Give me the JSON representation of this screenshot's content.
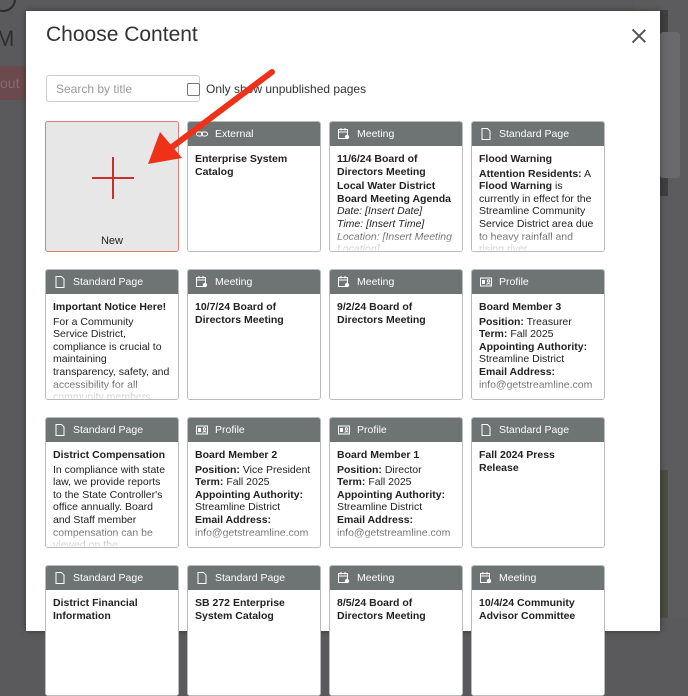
{
  "background": {
    "title_fragment": "M L",
    "about_fragment": "out",
    "accent_color": "#c9302c"
  },
  "modal": {
    "title": "Choose Content",
    "close_label": "Close",
    "search": {
      "placeholder": "Search by title",
      "value": ""
    },
    "unpublished_filter": {
      "label": "Only show unpublished pages",
      "checked": false
    },
    "new_card": {
      "label": "New"
    }
  },
  "cards": [
    {
      "type": "External",
      "icon": "link-icon",
      "title": "Enterprise System Catalog",
      "lines": []
    },
    {
      "type": "Meeting",
      "icon": "calendar-icon",
      "title": "11/6/24 Board of Directors Meeting",
      "lines": [
        {
          "style": "bold",
          "text": "Local Water District Board Meeting Agenda"
        },
        {
          "style": "italic",
          "text": "Date: [Insert Date]"
        },
        {
          "style": "italic",
          "text": "Time: [Insert Time]"
        },
        {
          "style": "italic",
          "text": "Location: [Insert Meeting Location]"
        }
      ]
    },
    {
      "type": "Standard Page",
      "icon": "page-icon",
      "title": "Flood Warning",
      "lines": [
        {
          "style": "mixed",
          "parts": [
            {
              "b": true,
              "text": "Attention Residents:"
            },
            {
              "b": false,
              "text": " A "
            },
            {
              "b": true,
              "text": "Flood Warning"
            },
            {
              "b": false,
              "text": " is currently in effect for the Streamline Community Service District area due to heavy rainfall and rising river"
            }
          ]
        }
      ]
    },
    {
      "type": "Standard Page",
      "icon": "page-icon",
      "title": "Important Notice Here!",
      "lines": [
        {
          "style": "normal",
          "text": "For a Community Service District, compliance is crucial to maintaining transparency, safety, and accessibility for all community members. Our district"
        }
      ]
    },
    {
      "type": "Meeting",
      "icon": "calendar-icon",
      "title": "10/7/24 Board of Directors Meeting",
      "lines": []
    },
    {
      "type": "Meeting",
      "icon": "calendar-icon",
      "title": "9/2/24 Board of Directors Meeting",
      "lines": []
    },
    {
      "type": "Profile",
      "icon": "profile-icon",
      "title": "Board Member 3",
      "lines": [
        {
          "style": "kv",
          "k": "Position:",
          "v": " Treasurer"
        },
        {
          "style": "kv",
          "k": "Term:",
          "v": " Fall 2025"
        },
        {
          "style": "bold",
          "text": "Appointing Authority:"
        },
        {
          "style": "normal",
          "text": "Streamline District"
        },
        {
          "style": "bold",
          "text": "Email Address:"
        },
        {
          "style": "normal",
          "text": "info@getstreamline.com"
        }
      ]
    },
    {
      "type": "Standard Page",
      "icon": "page-icon",
      "title": "District Compensation",
      "lines": [
        {
          "style": "normal",
          "text": "In compliance with state law, we provide reports to the State Controller's office annually. Board and Staff member compensation can be viewed on the"
        }
      ]
    },
    {
      "type": "Profile",
      "icon": "profile-icon",
      "title": "Board Member 2",
      "lines": [
        {
          "style": "kv",
          "k": "Position:",
          "v": " Vice President"
        },
        {
          "style": "kv",
          "k": "Term:",
          "v": " Fall 2025"
        },
        {
          "style": "bold",
          "text": "Appointing Authority:"
        },
        {
          "style": "normal",
          "text": "Streamline District"
        },
        {
          "style": "bold",
          "text": "Email Address:"
        },
        {
          "style": "normal",
          "text": "info@getstreamline.com"
        }
      ]
    },
    {
      "type": "Profile",
      "icon": "profile-icon",
      "title": "Board Member 1",
      "lines": [
        {
          "style": "kv",
          "k": "Position:",
          "v": " Director"
        },
        {
          "style": "kv",
          "k": "Term:",
          "v": " Fall 2025"
        },
        {
          "style": "bold",
          "text": "Appointing Authority:"
        },
        {
          "style": "normal",
          "text": "Streamline District"
        },
        {
          "style": "bold",
          "text": "Email Address:"
        },
        {
          "style": "normal",
          "text": "info@getstreamline.com"
        }
      ]
    },
    {
      "type": "Standard Page",
      "icon": "page-icon",
      "title": "Fall 2024 Press Release",
      "lines": []
    },
    {
      "type": "Standard Page",
      "icon": "page-icon",
      "title": "District Financial Information",
      "lines": []
    },
    {
      "type": "Standard Page",
      "icon": "page-icon",
      "title": "SB 272 Enterprise System Catalog",
      "lines": []
    },
    {
      "type": "Meeting",
      "icon": "calendar-icon",
      "title": "8/5/24 Board of Directors Meeting",
      "lines": []
    },
    {
      "type": "Meeting",
      "icon": "calendar-icon",
      "title": "10/4/24 Community Advisor Committee",
      "lines": []
    }
  ],
  "annotation": {
    "type": "arrow",
    "color": "#f0311a",
    "points_to": "new-card"
  }
}
